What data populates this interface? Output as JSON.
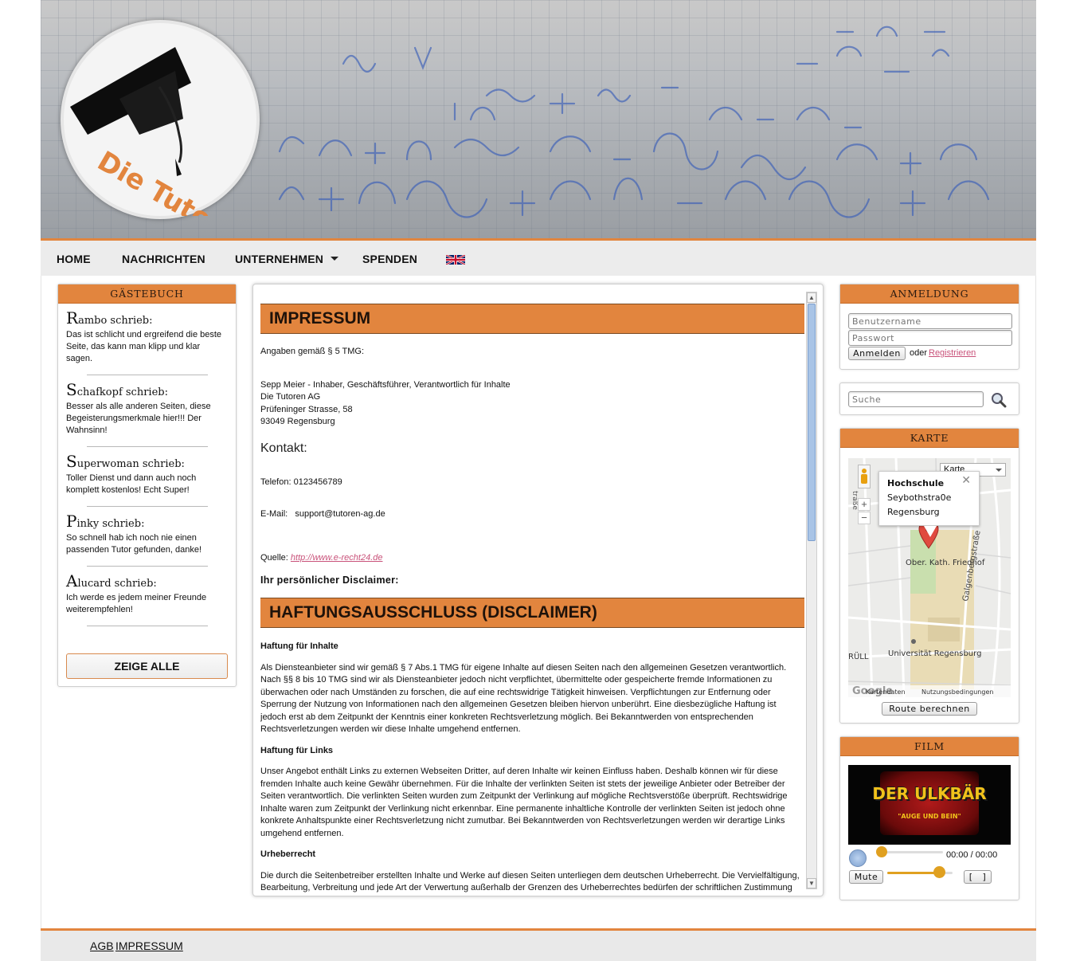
{
  "header": {
    "logo_text": "Die Tutoren AG"
  },
  "nav": {
    "items": [
      "HOME",
      "NACHRICHTEN",
      "UNTERNEHMEN",
      "SPENDEN"
    ],
    "flag": "uk-flag-icon"
  },
  "guestbook": {
    "title": "GÄSTEBUCH",
    "entries": [
      {
        "initial": "R",
        "name_rest": "ambo schrieb:",
        "text": "Das ist schlicht und ergreifend die beste Seite, das kann man klipp und klar sagen."
      },
      {
        "initial": "S",
        "name_rest": "chafkopf schrieb:",
        "text": "Besser als alle anderen Seiten, diese Begeisterungsmerkmale hier!!! Der Wahnsinn!"
      },
      {
        "initial": "S",
        "name_rest": "uperwoman schrieb:",
        "text": "Toller Dienst und dann auch noch komplett kostenlos! Echt Super!"
      },
      {
        "initial": "P",
        "name_rest": "inky schrieb:",
        "text": "So schnell hab ich noch nie einen passenden Tutor gefunden, danke!"
      },
      {
        "initial": "A",
        "name_rest": "lucard schrieb:",
        "text": "Ich werde es jedem meiner Freunde weiterempfehlen!"
      }
    ],
    "show_all": "ZEIGE ALLE"
  },
  "main": {
    "title": "IMPRESSUM",
    "tmg_line": "Angaben gemäß § 5 TMG:",
    "address": [
      "Sepp Meier - Inhaber, Geschäftsführer, Verantwortlich für Inhalte",
      "Die Tutoren AG",
      "Prüfeninger Strasse, 58",
      "93049 Regensburg"
    ],
    "kontakt_heading": "Kontakt:",
    "telefon": "Telefon: 0123456789",
    "email_label": "E-Mail:",
    "email_value": "support@tutoren-ag.de",
    "quelle_label": "Quelle:",
    "quelle_link": "http://www.e-recht24.de",
    "disclaimer_sub": "Ihr persönlicher Disclaimer:",
    "disclaimer_title": "HAFTUNGSAUSSCHLUSS (DISCLAIMER)",
    "sections": [
      {
        "heading": "Haftung für Inhalte",
        "text": "Als Diensteanbieter sind wir gemäß § 7 Abs.1 TMG für eigene Inhalte auf diesen Seiten nach den allgemeinen Gesetzen verantwortlich. Nach §§ 8 bis 10 TMG sind wir als Diensteanbieter jedoch nicht verpflichtet, übermittelte oder gespeicherte fremde Informationen zu überwachen oder nach Umständen zu forschen, die auf eine rechtswidrige Tätigkeit hinweisen. Verpflichtungen zur Entfernung oder Sperrung der Nutzung von Informationen nach den allgemeinen Gesetzen bleiben hiervon unberührt. Eine diesbezügliche Haftung ist jedoch erst ab dem Zeitpunkt der Kenntnis einer konkreten Rechtsverletzung möglich. Bei Bekanntwerden von entsprechenden Rechtsverletzungen werden wir diese Inhalte umgehend entfernen."
      },
      {
        "heading": "Haftung für Links",
        "text": "Unser Angebot enthält Links zu externen Webseiten Dritter, auf deren Inhalte wir keinen Einfluss haben. Deshalb können wir für diese fremden Inhalte auch keine Gewähr übernehmen. Für die Inhalte der verlinkten Seiten ist stets der jeweilige Anbieter oder Betreiber der Seiten verantwortlich. Die verlinkten Seiten wurden zum Zeitpunkt der Verlinkung auf mögliche Rechtsverstöße überprüft. Rechtswidrige Inhalte waren zum Zeitpunkt der Verlinkung nicht erkennbar. Eine permanente inhaltliche Kontrolle der verlinkten Seiten ist jedoch ohne konkrete Anhaltspunkte einer Rechtsverletzung nicht zumutbar. Bei Bekanntwerden von Rechtsverletzungen werden wir derartige Links umgehend entfernen."
      },
      {
        "heading": "Urheberrecht",
        "text": "Die durch die Seitenbetreiber erstellten Inhalte und Werke auf diesen Seiten unterliegen dem deutschen Urheberrecht. Die Vervielfältigung, Bearbeitung, Verbreitung und jede Art der Verwertung außerhalb der Grenzen des Urheberrechtes bedürfen der schriftlichen Zustimmung"
      }
    ]
  },
  "login": {
    "title": "ANMELDUNG",
    "username_placeholder": "Benutzername",
    "password_placeholder": "Passwort",
    "login_button": "Anmelden",
    "or_text": "oder",
    "register_link": "Registrieren"
  },
  "search": {
    "placeholder": "Suche",
    "icon": "search-icon"
  },
  "map": {
    "title": "KARTE",
    "map_type": "Karte",
    "info_title": "Hochschule",
    "info_line1": "Seybothstra0e",
    "info_line2": "Regensburg",
    "label_friedhof": "Ober. Kath. Friedhof",
    "label_uni": "Universität Regensburg",
    "label_street1": "Galgenbergstraße",
    "label_rull": "RÜLL",
    "label_strasse": "traße",
    "attribution": "Kartendaten",
    "terms": "Nutzungsbedingungen",
    "google": "Google",
    "route_button": "Route berechnen"
  },
  "film": {
    "title": "FILM",
    "video_title": "DER ULKBÄR",
    "video_subtitle": "\"AUGE UND BEIN\"",
    "time": "00:00 / 00:00",
    "mute_label": "Mute",
    "fullscreen_label": "[   ]",
    "progress": 0,
    "volume": 0.8
  },
  "footer": {
    "links": [
      "AGB",
      "IMPRESSUM"
    ]
  },
  "colors": {
    "accent": "#e2853e",
    "link": "#c9527a"
  }
}
